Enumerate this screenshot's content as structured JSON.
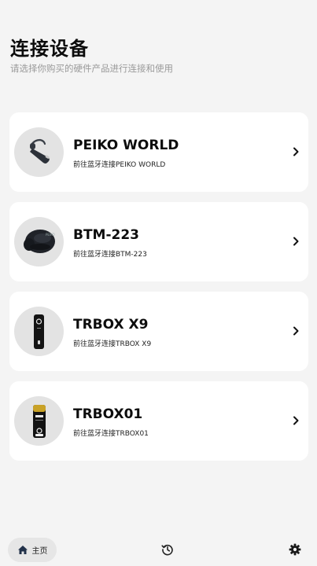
{
  "header": {
    "title": "连接设备",
    "subtitle": "请选择你购买的硬件产品进行连接和使用"
  },
  "devices": [
    {
      "name": "PEIKO WORLD",
      "desc": "前往蓝牙连接PEIKO WORLD",
      "icon": "earpiece-headset-icon"
    },
    {
      "name": "BTM-223",
      "desc": "前往蓝牙连接BTM-223",
      "icon": "earbud-icon"
    },
    {
      "name": "TRBOX X9",
      "desc": "前往蓝牙连接TRBOX X9",
      "icon": "trbox-x9-device-icon"
    },
    {
      "name": "TRBOX01",
      "desc": "前往蓝牙连接TRBOX01",
      "icon": "trbox01-device-icon"
    }
  ],
  "bottom_nav": {
    "home_label": "主页",
    "home_icon": "home-icon",
    "history_icon": "history-icon",
    "settings_icon": "gear-icon"
  },
  "colors": {
    "background": "#f4f4f4",
    "card": "#ffffff",
    "subtitle": "#9a9a9a"
  }
}
